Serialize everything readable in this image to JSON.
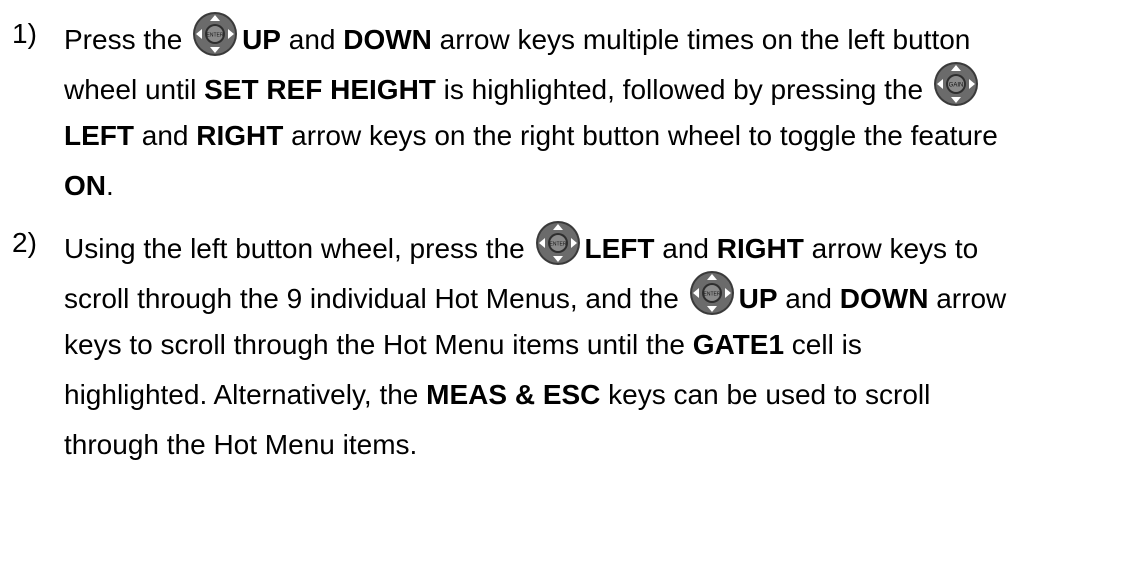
{
  "steps": [
    {
      "number": "1)",
      "lines": [
        [
          "Press the ",
          "",
          "UP",
          " and ",
          "DOWN",
          " arrow keys multiple times on the left button"
        ],
        [
          "wheel until ",
          "SET REF HEIGHT",
          " is highlighted, followed by pressing the ",
          ""
        ],
        [
          "LEFT",
          " and ",
          "RIGHT",
          " arrow keys on the right button wheel to toggle the feature"
        ],
        [
          "ON",
          "."
        ]
      ]
    },
    {
      "number": "2)",
      "lines": [
        [
          "Using the left button wheel, press the ",
          "",
          "LEFT",
          " and ",
          "RIGHT",
          " arrow keys to"
        ],
        [
          "scroll through the 9 individual Hot Menus, and the ",
          "",
          "UP",
          " and ",
          "DOWN",
          " arrow"
        ],
        [
          "keys to scroll through the Hot Menu items until the ",
          "GATE1",
          " cell is"
        ],
        [
          "highlighted.  Alternatively, the ",
          "MEAS & ESC",
          " keys can be used to scroll"
        ],
        [
          "through the Hot Menu items."
        ]
      ]
    }
  ],
  "icons": {
    "left_wheel": "button-wheel-enter-icon",
    "right_wheel": "button-wheel-gain-icon",
    "wheel_color": "#555555",
    "arrow_color": "#ffffff"
  }
}
